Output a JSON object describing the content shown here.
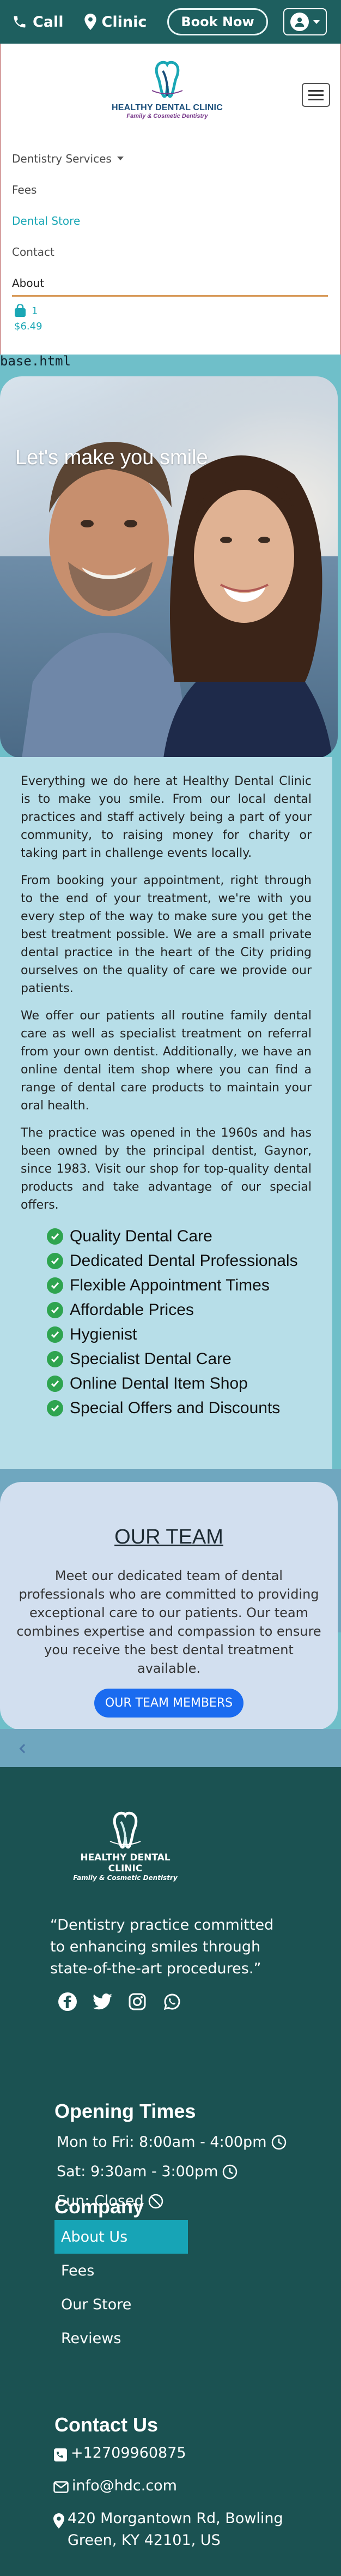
{
  "topbar": {
    "call_label": "Call",
    "clinic_label": "Clinic",
    "book_label": "Book Now",
    "icons": [
      "phone-icon",
      "map-pin-icon",
      "user-icon"
    ]
  },
  "logo": {
    "name": "HEALTHY DENTAL CLINIC",
    "tagline": "Family & Cosmetic Dentistry"
  },
  "nav": {
    "items": [
      {
        "label": "Dentistry Services",
        "dropdown": true,
        "state": "default"
      },
      {
        "label": "Fees",
        "state": "default"
      },
      {
        "label": "Dental Store",
        "state": "active"
      },
      {
        "label": "Contact",
        "state": "default"
      },
      {
        "label": "About",
        "state": "current"
      }
    ],
    "cart_count": "1",
    "cart_total": "$6.49"
  },
  "base_file": "base.html",
  "hero": {
    "title": "Let's make you smile"
  },
  "about": {
    "paragraphs": [
      "Everything we do here at Healthy Dental Clinic is to make you smile. From our local dental practices and staff actively being a part of your community, to raising money for charity or taking part in challenge events locally.",
      "From booking your appointment, right through to the end of your treatment, we're with you every step of the way to make sure you get the best treatment possible. We are a small private dental practice in the heart of the City priding ourselves on the quality of care we provide our patients.",
      "We offer our patients all routine family dental care as well as specialist treatment on referral from your own dentist. Additionally, we have an online dental item shop where you can find a range of dental care products to maintain your oral health.",
      "The practice was opened in the 1960s and has been owned by the principal dentist, Gaynor, since 1983. Visit our shop for top-quality dental products and take advantage of our special offers."
    ],
    "features": [
      "Quality Dental Care",
      "Dedicated Dental Professionals",
      "Flexible Appointment Times",
      "Affordable Prices",
      "Hygienist",
      "Specialist Dental Care",
      "Online Dental Item Shop",
      "Special Offers and Discounts"
    ]
  },
  "team": {
    "heading": "OUR TEAM",
    "text": "Meet our dedicated team of dental professionals who are committed to providing exceptional care to our patients. Our team combines expertise and compassion to ensure you receive the best dental treatment available.",
    "button": "OUR TEAM MEMBERS"
  },
  "footer": {
    "logo_name": "HEALTHY DENTAL CLINIC",
    "logo_tagline": "Family & Cosmetic Dentistry",
    "tagline": "“Dentistry practice committed to enhancing smiles through state-of-the-art procedures.”",
    "social_icons": [
      "facebook-icon",
      "twitter-icon",
      "instagram-icon",
      "whatsapp-icon"
    ],
    "hours_heading": "Opening Times",
    "hours": [
      "Mon to Fri: 8:00am - 4:00pm",
      "Sat: 9:30am - 3:00pm",
      "Sun: Closed"
    ],
    "company_heading": "Company",
    "company_links": [
      "About Us",
      "Fees",
      "Our Store",
      "Reviews"
    ],
    "contact_heading": "Contact Us",
    "phone": "+12709960875",
    "email": "info@hdc.com",
    "address": "420 Morgantown Rd, Bowling Green, KY 42101, US"
  },
  "colors": {
    "topbar": "#1e5f5f",
    "accent": "#1aa7b5",
    "footer": "#1b5252",
    "team_button": "#1a6bf0",
    "check": "#2ea44f"
  }
}
